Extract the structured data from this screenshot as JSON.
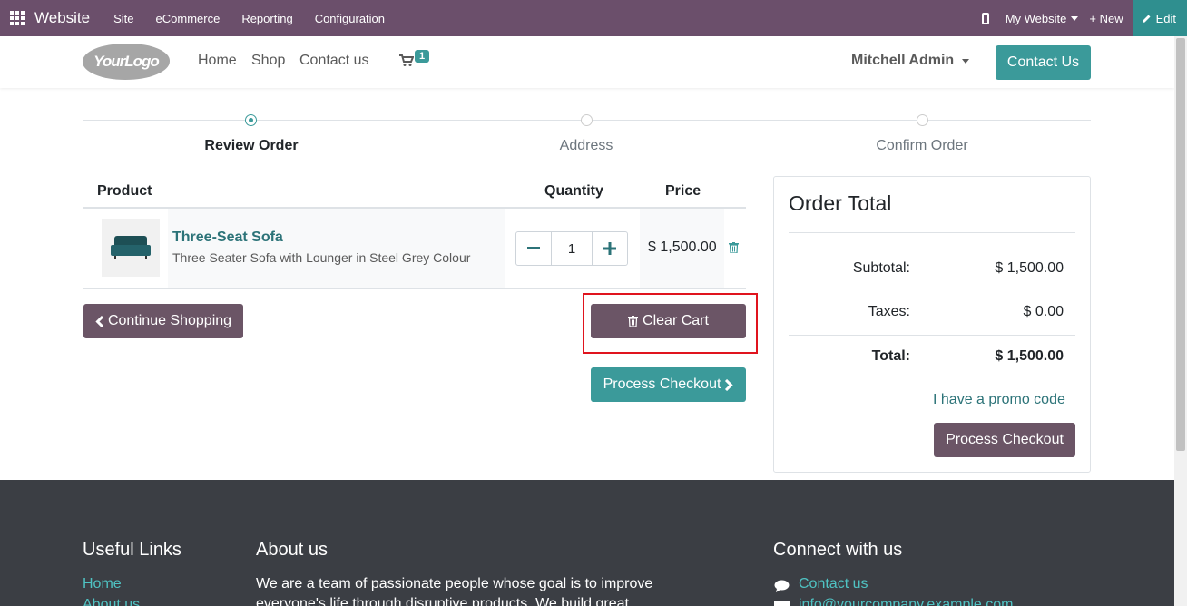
{
  "admin_bar": {
    "brand": "Website",
    "menus": [
      "Site",
      "eCommerce",
      "Reporting",
      "Configuration"
    ],
    "my_website": "My Website",
    "new_label": "New",
    "edit_label": "Edit"
  },
  "header": {
    "logo_text": "YourLogo",
    "nav": [
      "Home",
      "Shop",
      "Contact us"
    ],
    "cart_count": "1",
    "user_name": "Mitchell Admin",
    "contact_button": "Contact Us"
  },
  "steps": [
    {
      "label": "Review Order",
      "active": true
    },
    {
      "label": "Address",
      "active": false
    },
    {
      "label": "Confirm Order",
      "active": false
    }
  ],
  "cart": {
    "headers": {
      "product": "Product",
      "quantity": "Quantity",
      "price": "Price"
    },
    "items": [
      {
        "name": "Three-Seat Sofa",
        "description": "Three Seater Sofa with Lounger in Steel Grey Colour",
        "quantity": "1",
        "price": "$ 1,500.00"
      }
    ],
    "continue_label": "Continue Shopping",
    "clear_label": "Clear Cart",
    "checkout_label": "Process Checkout"
  },
  "order_total": {
    "title": "Order Total",
    "subtotal_label": "Subtotal:",
    "subtotal_value": "$ 1,500.00",
    "taxes_label": "Taxes:",
    "taxes_value": "$ 0.00",
    "total_label": "Total:",
    "total_value": "$ 1,500.00",
    "promo_label": "I have a promo code",
    "checkout_label": "Process Checkout"
  },
  "footer": {
    "useful_links_title": "Useful Links",
    "links": [
      "Home",
      "About us"
    ],
    "about_title": "About us",
    "about_text": "We are a team of passionate people whose goal is to improve everyone's life through disruptive products. We build great",
    "connect_title": "Connect with us",
    "connect_items": [
      "Contact us",
      "info@yourcompany.example.com"
    ]
  },
  "colors": {
    "admin_bar": "#6b4f6b",
    "primary": "#3b9a9a",
    "secondary": "#6b5566",
    "footer": "#3b3e44",
    "highlight": "#e0141e"
  }
}
